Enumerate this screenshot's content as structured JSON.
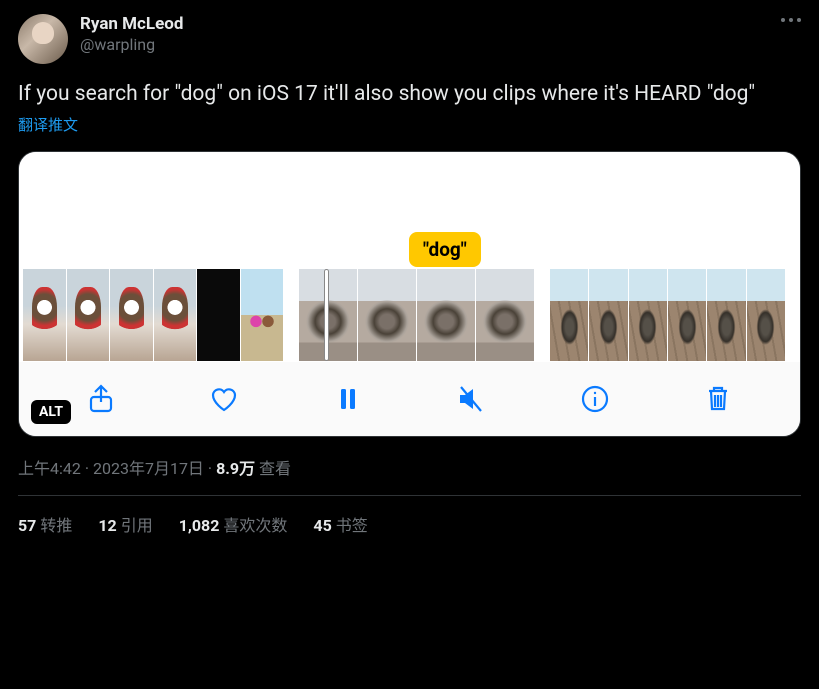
{
  "author": {
    "display_name": "Ryan McLeod",
    "handle": "@warpling"
  },
  "tweet_text": "If you search for \"dog\" on iOS 17 it'll also show you clips where it's HEARD \"dog\"",
  "translate_label": "翻译推文",
  "media": {
    "caption_bubble": "\"dog\"",
    "alt_badge": "ALT"
  },
  "meta": {
    "time": "上午4:42",
    "date": "2023年7月17日",
    "views_number": "8.9万",
    "views_label": "查看",
    "separator": " · "
  },
  "stats": {
    "retweets_n": "57",
    "retweets_label": "转推",
    "quotes_n": "12",
    "quotes_label": "引用",
    "likes_n": "1,082",
    "likes_label": "喜欢次数",
    "bookmarks_n": "45",
    "bookmarks_label": "书签"
  }
}
